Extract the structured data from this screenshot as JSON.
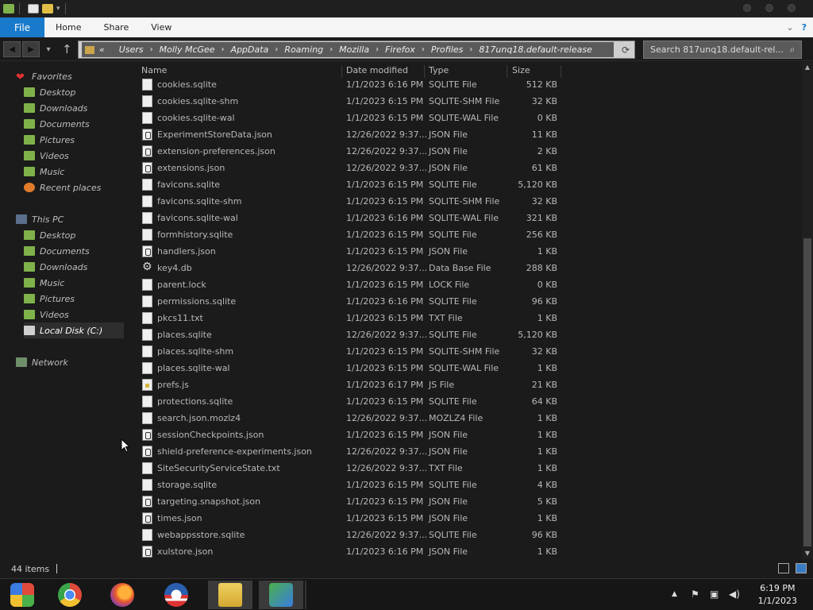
{
  "ribbon": {
    "file_label": "File",
    "tabs": [
      "Home",
      "Share",
      "View"
    ]
  },
  "address": {
    "overflow_glyph": "«",
    "crumbs": [
      "Users",
      "Molly McGee",
      "AppData",
      "Roaming",
      "Mozilla",
      "Firefox",
      "Profiles",
      "817unq18.default-release"
    ],
    "separator_glyph": "›"
  },
  "search": {
    "placeholder": "Search 817unq18.default-rel..."
  },
  "nav": {
    "favorites_label": "Favorites",
    "favorites": [
      "Desktop",
      "Downloads",
      "Documents",
      "Pictures",
      "Videos",
      "Music",
      "Recent places"
    ],
    "this_pc_label": "This PC",
    "this_pc": [
      "Desktop",
      "Documents",
      "Downloads",
      "Music",
      "Pictures",
      "Videos",
      "Local Disk (C:)"
    ],
    "network_label": "Network"
  },
  "columns": {
    "name": "Name",
    "date": "Date modified",
    "type": "Type",
    "size": "Size"
  },
  "files": [
    {
      "name": "cookies.sqlite",
      "date": "1/1/2023 6:16 PM",
      "type": "SQLITE File",
      "size": "512 KB",
      "icon": "doc"
    },
    {
      "name": "cookies.sqlite-shm",
      "date": "1/1/2023 6:15 PM",
      "type": "SQLITE-SHM File",
      "size": "32 KB",
      "icon": "doc"
    },
    {
      "name": "cookies.sqlite-wal",
      "date": "1/1/2023 6:15 PM",
      "type": "SQLITE-WAL File",
      "size": "0 KB",
      "icon": "doc"
    },
    {
      "name": "ExperimentStoreData.json",
      "date": "12/26/2022 9:37...",
      "type": "JSON File",
      "size": "11 KB",
      "icon": "json"
    },
    {
      "name": "extension-preferences.json",
      "date": "12/26/2022 9:37...",
      "type": "JSON File",
      "size": "2 KB",
      "icon": "json"
    },
    {
      "name": "extensions.json",
      "date": "12/26/2022 9:37...",
      "type": "JSON File",
      "size": "61 KB",
      "icon": "json"
    },
    {
      "name": "favicons.sqlite",
      "date": "1/1/2023 6:15 PM",
      "type": "SQLITE File",
      "size": "5,120 KB",
      "icon": "doc"
    },
    {
      "name": "favicons.sqlite-shm",
      "date": "1/1/2023 6:15 PM",
      "type": "SQLITE-SHM File",
      "size": "32 KB",
      "icon": "doc"
    },
    {
      "name": "favicons.sqlite-wal",
      "date": "1/1/2023 6:16 PM",
      "type": "SQLITE-WAL File",
      "size": "321 KB",
      "icon": "doc"
    },
    {
      "name": "formhistory.sqlite",
      "date": "1/1/2023 6:15 PM",
      "type": "SQLITE File",
      "size": "256 KB",
      "icon": "doc"
    },
    {
      "name": "handlers.json",
      "date": "1/1/2023 6:15 PM",
      "type": "JSON File",
      "size": "1 KB",
      "icon": "json"
    },
    {
      "name": "key4.db",
      "date": "12/26/2022 9:37...",
      "type": "Data Base File",
      "size": "288 KB",
      "icon": "gear"
    },
    {
      "name": "parent.lock",
      "date": "1/1/2023 6:15 PM",
      "type": "LOCK File",
      "size": "0 KB",
      "icon": "doc"
    },
    {
      "name": "permissions.sqlite",
      "date": "1/1/2023 6:16 PM",
      "type": "SQLITE File",
      "size": "96 KB",
      "icon": "doc"
    },
    {
      "name": "pkcs11.txt",
      "date": "1/1/2023 6:15 PM",
      "type": "TXT File",
      "size": "1 KB",
      "icon": "doc"
    },
    {
      "name": "places.sqlite",
      "date": "12/26/2022 9:37...",
      "type": "SQLITE File",
      "size": "5,120 KB",
      "icon": "doc"
    },
    {
      "name": "places.sqlite-shm",
      "date": "1/1/2023 6:15 PM",
      "type": "SQLITE-SHM File",
      "size": "32 KB",
      "icon": "doc"
    },
    {
      "name": "places.sqlite-wal",
      "date": "1/1/2023 6:15 PM",
      "type": "SQLITE-WAL File",
      "size": "1 KB",
      "icon": "doc"
    },
    {
      "name": "prefs.js",
      "date": "1/1/2023 6:17 PM",
      "type": "JS File",
      "size": "21 KB",
      "icon": "js"
    },
    {
      "name": "protections.sqlite",
      "date": "1/1/2023 6:15 PM",
      "type": "SQLITE File",
      "size": "64 KB",
      "icon": "doc"
    },
    {
      "name": "search.json.mozlz4",
      "date": "12/26/2022 9:37...",
      "type": "MOZLZ4 File",
      "size": "1 KB",
      "icon": "doc"
    },
    {
      "name": "sessionCheckpoints.json",
      "date": "1/1/2023 6:15 PM",
      "type": "JSON File",
      "size": "1 KB",
      "icon": "json"
    },
    {
      "name": "shield-preference-experiments.json",
      "date": "12/26/2022 9:37...",
      "type": "JSON File",
      "size": "1 KB",
      "icon": "json"
    },
    {
      "name": "SiteSecurityServiceState.txt",
      "date": "12/26/2022 9:37...",
      "type": "TXT File",
      "size": "1 KB",
      "icon": "doc"
    },
    {
      "name": "storage.sqlite",
      "date": "1/1/2023 6:15 PM",
      "type": "SQLITE File",
      "size": "4 KB",
      "icon": "doc"
    },
    {
      "name": "targeting.snapshot.json",
      "date": "1/1/2023 6:15 PM",
      "type": "JSON File",
      "size": "5 KB",
      "icon": "json"
    },
    {
      "name": "times.json",
      "date": "1/1/2023 6:15 PM",
      "type": "JSON File",
      "size": "1 KB",
      "icon": "json"
    },
    {
      "name": "webappsstore.sqlite",
      "date": "12/26/2022 9:37...",
      "type": "SQLITE File",
      "size": "96 KB",
      "icon": "doc"
    },
    {
      "name": "xulstore.json",
      "date": "1/1/2023 6:16 PM",
      "type": "JSON File",
      "size": "1 KB",
      "icon": "json"
    }
  ],
  "status": {
    "item_count": "44 items"
  },
  "clock": {
    "time": "6:19 PM",
    "date": "1/1/2023"
  },
  "taskbar": {
    "apps": [
      "start-icon",
      "chrome-icon",
      "firefox-icon",
      "obama-logo-icon",
      "file-explorer-icon",
      "network-people-icon"
    ]
  },
  "colors": {
    "accent": "#1979ca",
    "background": "#1b1b1b",
    "text": "#b8b8b8"
  }
}
